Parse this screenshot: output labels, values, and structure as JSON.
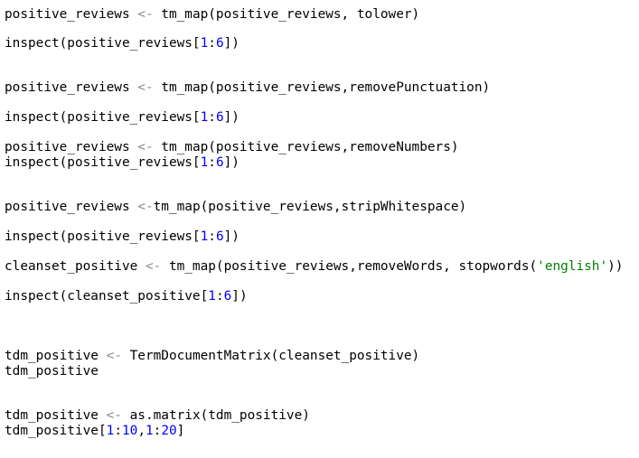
{
  "colors": {
    "background": "#ffffff",
    "text": "#000000",
    "operator": "#8a8a8a",
    "number": "#0000ff",
    "string": "#008000"
  },
  "code_lines": [
    {
      "tokens": [
        {
          "t": "positive_reviews ",
          "c": ""
        },
        {
          "t": "<-",
          "c": "op"
        },
        {
          "t": " tm_map(positive_reviews, tolower)",
          "c": ""
        }
      ]
    },
    {
      "tokens": [
        {
          "t": "inspect(positive_reviews[",
          "c": ""
        },
        {
          "t": "1",
          "c": "num"
        },
        {
          "t": ":",
          "c": ""
        },
        {
          "t": "6",
          "c": "num"
        },
        {
          "t": "])",
          "c": ""
        }
      ]
    },
    {
      "tokens": [
        {
          "t": "positive_reviews ",
          "c": ""
        },
        {
          "t": "<-",
          "c": "op"
        },
        {
          "t": " tm_map(positive_reviews,removePunctuation)",
          "c": ""
        }
      ]
    },
    {
      "tokens": [
        {
          "t": "inspect(positive_reviews[",
          "c": ""
        },
        {
          "t": "1",
          "c": "num"
        },
        {
          "t": ":",
          "c": ""
        },
        {
          "t": "6",
          "c": "num"
        },
        {
          "t": "])",
          "c": ""
        }
      ]
    },
    {
      "tokens": [
        {
          "t": "positive_reviews ",
          "c": ""
        },
        {
          "t": "<-",
          "c": "op"
        },
        {
          "t": " tm_map(positive_reviews,removeNumbers)",
          "c": ""
        }
      ]
    },
    {
      "tokens": [
        {
          "t": "inspect(positive_reviews[",
          "c": ""
        },
        {
          "t": "1",
          "c": "num"
        },
        {
          "t": ":",
          "c": ""
        },
        {
          "t": "6",
          "c": "num"
        },
        {
          "t": "])",
          "c": ""
        }
      ]
    },
    {
      "tokens": [
        {
          "t": "positive_reviews ",
          "c": ""
        },
        {
          "t": "<-",
          "c": "op"
        },
        {
          "t": "tm_map(positive_reviews,stripWhitespace)",
          "c": ""
        }
      ]
    },
    {
      "tokens": [
        {
          "t": "inspect(positive_reviews[",
          "c": ""
        },
        {
          "t": "1",
          "c": "num"
        },
        {
          "t": ":",
          "c": ""
        },
        {
          "t": "6",
          "c": "num"
        },
        {
          "t": "])",
          "c": ""
        }
      ]
    },
    {
      "tokens": [
        {
          "t": "cleanset_positive ",
          "c": ""
        },
        {
          "t": "<-",
          "c": "op"
        },
        {
          "t": " tm_map(positive_reviews,removeWords, stopwords(",
          "c": ""
        },
        {
          "t": "'english'",
          "c": "str"
        },
        {
          "t": "))",
          "c": ""
        }
      ]
    },
    {
      "tokens": [
        {
          "t": "inspect(cleanset_positive[",
          "c": ""
        },
        {
          "t": "1",
          "c": "num"
        },
        {
          "t": ":",
          "c": ""
        },
        {
          "t": "6",
          "c": "num"
        },
        {
          "t": "])",
          "c": ""
        }
      ]
    },
    {
      "tokens": [
        {
          "t": "tdm_positive ",
          "c": ""
        },
        {
          "t": "<-",
          "c": "op"
        },
        {
          "t": " TermDocumentMatrix(cleanset_positive)",
          "c": ""
        }
      ]
    },
    {
      "tokens": [
        {
          "t": "tdm_positive",
          "c": ""
        }
      ]
    },
    {
      "tokens": [
        {
          "t": "tdm_positive ",
          "c": ""
        },
        {
          "t": "<-",
          "c": "op"
        },
        {
          "t": " as.matrix(tdm_positive)",
          "c": ""
        }
      ]
    },
    {
      "tokens": [
        {
          "t": "tdm_positive[",
          "c": ""
        },
        {
          "t": "1",
          "c": "num"
        },
        {
          "t": ":",
          "c": ""
        },
        {
          "t": "10",
          "c": "num"
        },
        {
          "t": ",",
          "c": ""
        },
        {
          "t": "1",
          "c": "num"
        },
        {
          "t": ":",
          "c": ""
        },
        {
          "t": "20",
          "c": "num"
        },
        {
          "t": "]",
          "c": ""
        }
      ]
    }
  ]
}
